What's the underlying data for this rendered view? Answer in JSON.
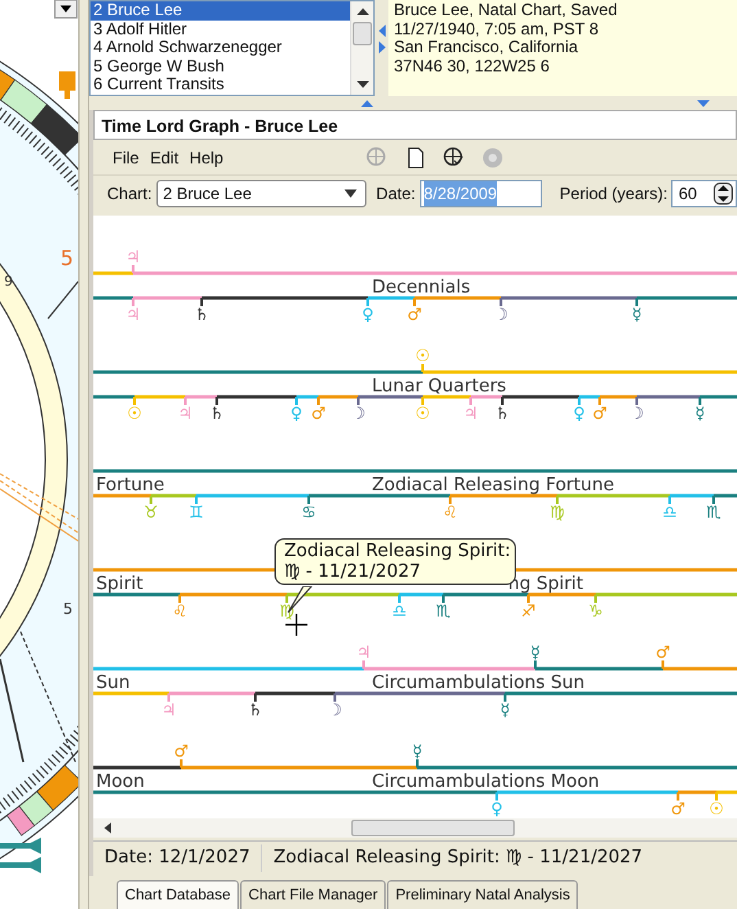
{
  "chart_wheel": {
    "labels": [
      {
        "text": "5",
        "color": "#e8702a"
      },
      {
        "text": "9",
        "color": "#333333"
      },
      {
        "text": "5",
        "color": "#333333"
      }
    ]
  },
  "chart_list": {
    "items": [
      {
        "text": "2 Bruce Lee",
        "selected": true
      },
      {
        "text": "3 Adolf Hitler",
        "selected": false
      },
      {
        "text": "4 Arnold Schwarzenegger",
        "selected": false
      },
      {
        "text": "5 George W Bush",
        "selected": false
      },
      {
        "text": "6 Current Transits",
        "selected": false
      }
    ]
  },
  "chart_info": {
    "lines": [
      "Bruce Lee, Natal Chart, Saved",
      "11/27/1940, 7:05 am, PST 8",
      "San Francisco, California",
      "37N46 30, 122W25 6"
    ]
  },
  "graph_window": {
    "title": "Time Lord Graph - Bruce Lee",
    "menu": [
      "File",
      "Edit",
      "Help"
    ],
    "chart_label": "Chart:",
    "chart_value": "2 Bruce Lee",
    "date_label": "Date:",
    "date_value": "8/28/2009",
    "period_label": "Period (years):",
    "period_value": "60",
    "tracks": [
      {
        "title": "Decennials",
        "upper": [
          {
            "color": "#f5c000"
          },
          {
            "symbol": "♃",
            "color": "#f49ac1"
          }
        ],
        "lower": [
          {
            "color": "#1a8080"
          },
          {
            "symbol": "♃",
            "color": "#f49ac1"
          },
          {
            "symbol": "♄",
            "color": "#333333"
          },
          {
            "symbol": "♀",
            "color": "#22c0e8"
          },
          {
            "symbol": "♂",
            "color": "#f0960a"
          },
          {
            "symbol": "☽",
            "color": "#6a6a90"
          },
          {
            "symbol": "☿",
            "color": "#1a8080"
          }
        ]
      },
      {
        "title": "Lunar Quarters",
        "upper": [
          {
            "color": "#1a8080"
          },
          {
            "symbol": "☉",
            "color": "#f5c000"
          }
        ],
        "lower": [
          {
            "color": "#1a8080"
          },
          {
            "symbol": "☉",
            "color": "#f5c000"
          },
          {
            "symbol": "♃",
            "color": "#f49ac1"
          },
          {
            "symbol": "♄",
            "color": "#333333"
          },
          {
            "symbol": "♀",
            "color": "#22c0e8"
          },
          {
            "symbol": "♂",
            "color": "#f0960a"
          },
          {
            "symbol": "☽",
            "color": "#6a6a90"
          },
          {
            "symbol": "☉",
            "color": "#f5c000"
          },
          {
            "symbol": "♃",
            "color": "#f49ac1"
          },
          {
            "symbol": "♄",
            "color": "#333333"
          },
          {
            "symbol": "♀",
            "color": "#22c0e8"
          },
          {
            "symbol": "♂",
            "color": "#f0960a"
          },
          {
            "symbol": "☽",
            "color": "#6a6a90"
          },
          {
            "symbol": "☿",
            "color": "#1a8080"
          }
        ]
      },
      {
        "label": "Fortune",
        "title": "Zodiacal Releasing Fortune",
        "upper": [
          {
            "color": "#1a8080"
          }
        ],
        "lower": [
          {
            "color": "#f0960a"
          },
          {
            "symbol": "♉",
            "color": "#a8c820"
          },
          {
            "symbol": "♊",
            "color": "#22c0e8"
          },
          {
            "symbol": "♋",
            "color": "#1a8080"
          },
          {
            "symbol": "♌",
            "color": "#f0960a"
          },
          {
            "symbol": "♍",
            "color": "#a8c820"
          },
          {
            "symbol": "♎",
            "color": "#22c0e8"
          },
          {
            "symbol": "♏",
            "color": "#1a8080"
          }
        ]
      },
      {
        "label": "Spirit",
        "title": "ng Spirit",
        "title_covered": true,
        "upper": [
          {
            "color": "#f0960a"
          }
        ],
        "lower": [
          {
            "color": "#1a8080"
          },
          {
            "symbol": "♌",
            "color": "#f0960a"
          },
          {
            "symbol": "♍",
            "color": "#a8c820"
          },
          {
            "symbol": "♎",
            "color": "#22c0e8"
          },
          {
            "symbol": "♏",
            "color": "#1a8080"
          },
          {
            "symbol": "♐",
            "color": "#f0960a"
          },
          {
            "symbol": "♑",
            "color": "#a8c820"
          }
        ]
      },
      {
        "label": "Sun",
        "title": "Circumambulations Sun",
        "upper": [
          {
            "color": "#22c0e8"
          },
          {
            "symbol": "♃",
            "color": "#f49ac1"
          },
          {
            "symbol": "☿",
            "color": "#1a8080"
          },
          {
            "symbol": "♂",
            "color": "#f0960a"
          }
        ],
        "lower": [
          {
            "color": "#f5c000"
          },
          {
            "symbol": "♃",
            "color": "#f49ac1"
          },
          {
            "symbol": "♄",
            "color": "#333333"
          },
          {
            "symbol": "☽",
            "color": "#6a6a90"
          },
          {
            "symbol": "☿",
            "color": "#1a8080"
          }
        ]
      },
      {
        "label": "Moon",
        "title": "Circumambulations Moon",
        "upper": [
          {
            "color": "#333333"
          },
          {
            "symbol": "♂",
            "color": "#f0960a"
          },
          {
            "symbol": "☿",
            "color": "#1a8080"
          }
        ],
        "lower": [
          {
            "color": "#1a8080"
          },
          {
            "symbol": "♀",
            "color": "#22c0e8"
          },
          {
            "symbol": "♂",
            "color": "#f0960a"
          },
          {
            "symbol": "☉",
            "color": "#f5c000"
          }
        ]
      }
    ],
    "tooltip": {
      "lines": [
        "Zodiacal Releasing Spirit:",
        "♍ - 11/21/2027"
      ]
    },
    "status_bar": [
      "Date: 12/1/2027",
      "Zodiacal Releasing Spirit:  ♍ - 11/21/2027"
    ]
  },
  "bottom_tabs": [
    {
      "label": "Chart Database",
      "selected": true
    },
    {
      "label": "Chart File Manager",
      "selected": false
    },
    {
      "label": "Preliminary Natal Analysis",
      "selected": false
    }
  ]
}
